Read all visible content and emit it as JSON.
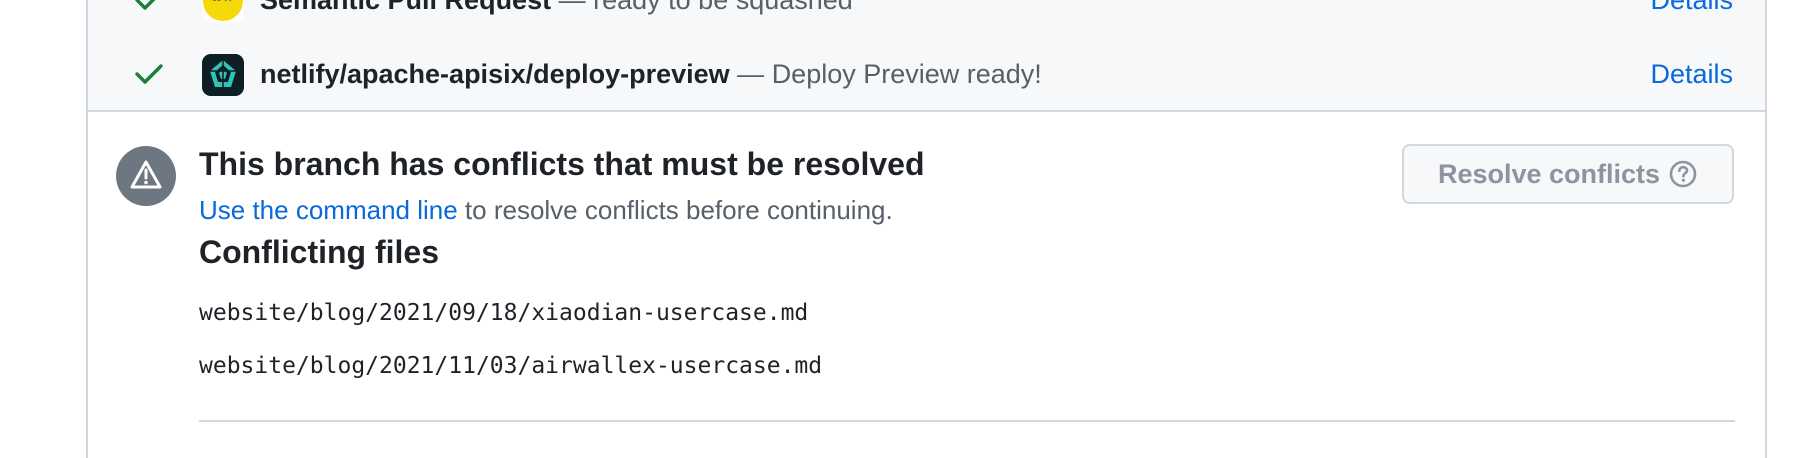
{
  "checks": [
    {
      "name": "Semantic Pull Request",
      "separator": "—",
      "status": "ready to be squashed",
      "details_label": "Details",
      "avatar_icon": "semantic-pr-app-icon",
      "result_icon": "check-icon"
    },
    {
      "name": "netlify/apache-apisix/deploy-preview",
      "separator": "—",
      "status": "Deploy Preview ready!",
      "details_label": "Details",
      "avatar_icon": "netlify-app-icon",
      "result_icon": "check-icon"
    }
  ],
  "conflicts": {
    "icon": "alert-icon",
    "title": "This branch has conflicts that must be resolved",
    "link_text": "Use the command line",
    "desc_rest": "to resolve conflicts before continuing.",
    "resolve_button_label": "Resolve conflicts",
    "resolve_button_icon": "question-icon",
    "files_heading": "Conflicting files",
    "files": [
      "website/blog/2021/09/18/xiaodian-usercase.md",
      "website/blog/2021/11/03/airwallex-usercase.md"
    ]
  },
  "colors": {
    "success": "#1a7f37",
    "link": "#0969da",
    "muted": "#57606a",
    "alert_bg": "#6e7781",
    "semantic_avatar": "#f5d90a",
    "netlify_avatar": "#0e1e25",
    "netlify_accent": "#31c3b5"
  }
}
